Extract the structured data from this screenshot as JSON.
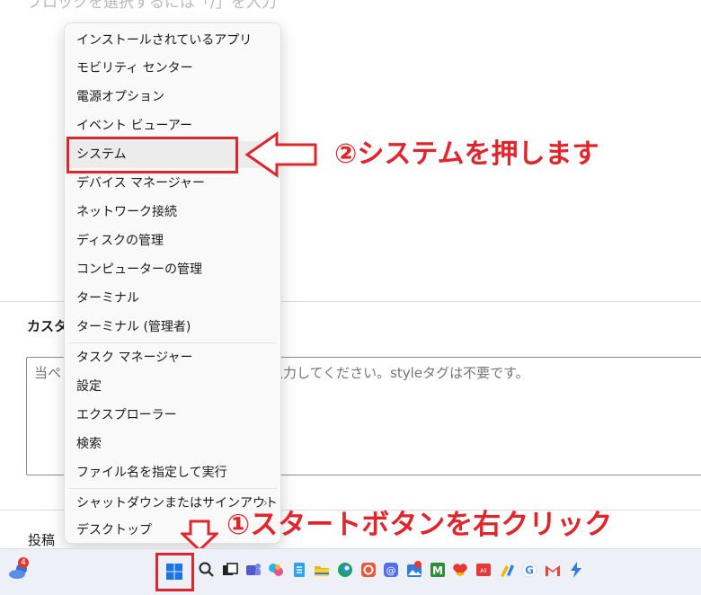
{
  "editor": {
    "block_hint": "ブロックを選択するには「/」を入力"
  },
  "custom_css": {
    "heading": "カスタム CSS",
    "placeholder_left": "当ペ",
    "placeholder_right": "入力してください。styleタグは不要です。"
  },
  "bottom_tabs": {
    "post_label": "投稿"
  },
  "context_menu": {
    "items": [
      {
        "label": "インストールされているアプリ"
      },
      {
        "label": "モビリティ センター"
      },
      {
        "label": "電源オプション"
      },
      {
        "label": "イベント ビューアー"
      },
      {
        "label": "システム",
        "highlighted": true
      },
      {
        "label": "デバイス マネージャー"
      },
      {
        "label": "ネットワーク接続"
      },
      {
        "label": "ディスクの管理"
      },
      {
        "label": "コンピューターの管理"
      },
      {
        "label": "ターミナル"
      },
      {
        "label": "ターミナル (管理者)"
      },
      {
        "label": "タスク マネージャー"
      },
      {
        "label": "設定"
      },
      {
        "label": "エクスプローラー"
      },
      {
        "label": "検索"
      },
      {
        "label": "ファイル名を指定して実行"
      },
      {
        "label": "シャットダウンまたはサインアウト",
        "submenu_arrow": "›"
      },
      {
        "label": "デスクトップ"
      }
    ]
  },
  "annotations": {
    "step2": "②システムを押します",
    "step1": "①スタートボタンを右クリック",
    "color": "#e0262c"
  },
  "taskbar": {
    "weather_badge": "4",
    "icons": [
      "start-icon",
      "search-icon",
      "task-view-icon",
      "teams-icon",
      "copilot-icon",
      "notepad-icon",
      "file-explorer-icon",
      "edge-icon",
      "app-icon",
      "mail-icon",
      "photos-icon",
      "m-app-icon",
      "heart-app-icon",
      "ali-app-icon",
      "pen-app-icon",
      "google-icon",
      "gmail-icon",
      "bolt-app-icon"
    ]
  }
}
